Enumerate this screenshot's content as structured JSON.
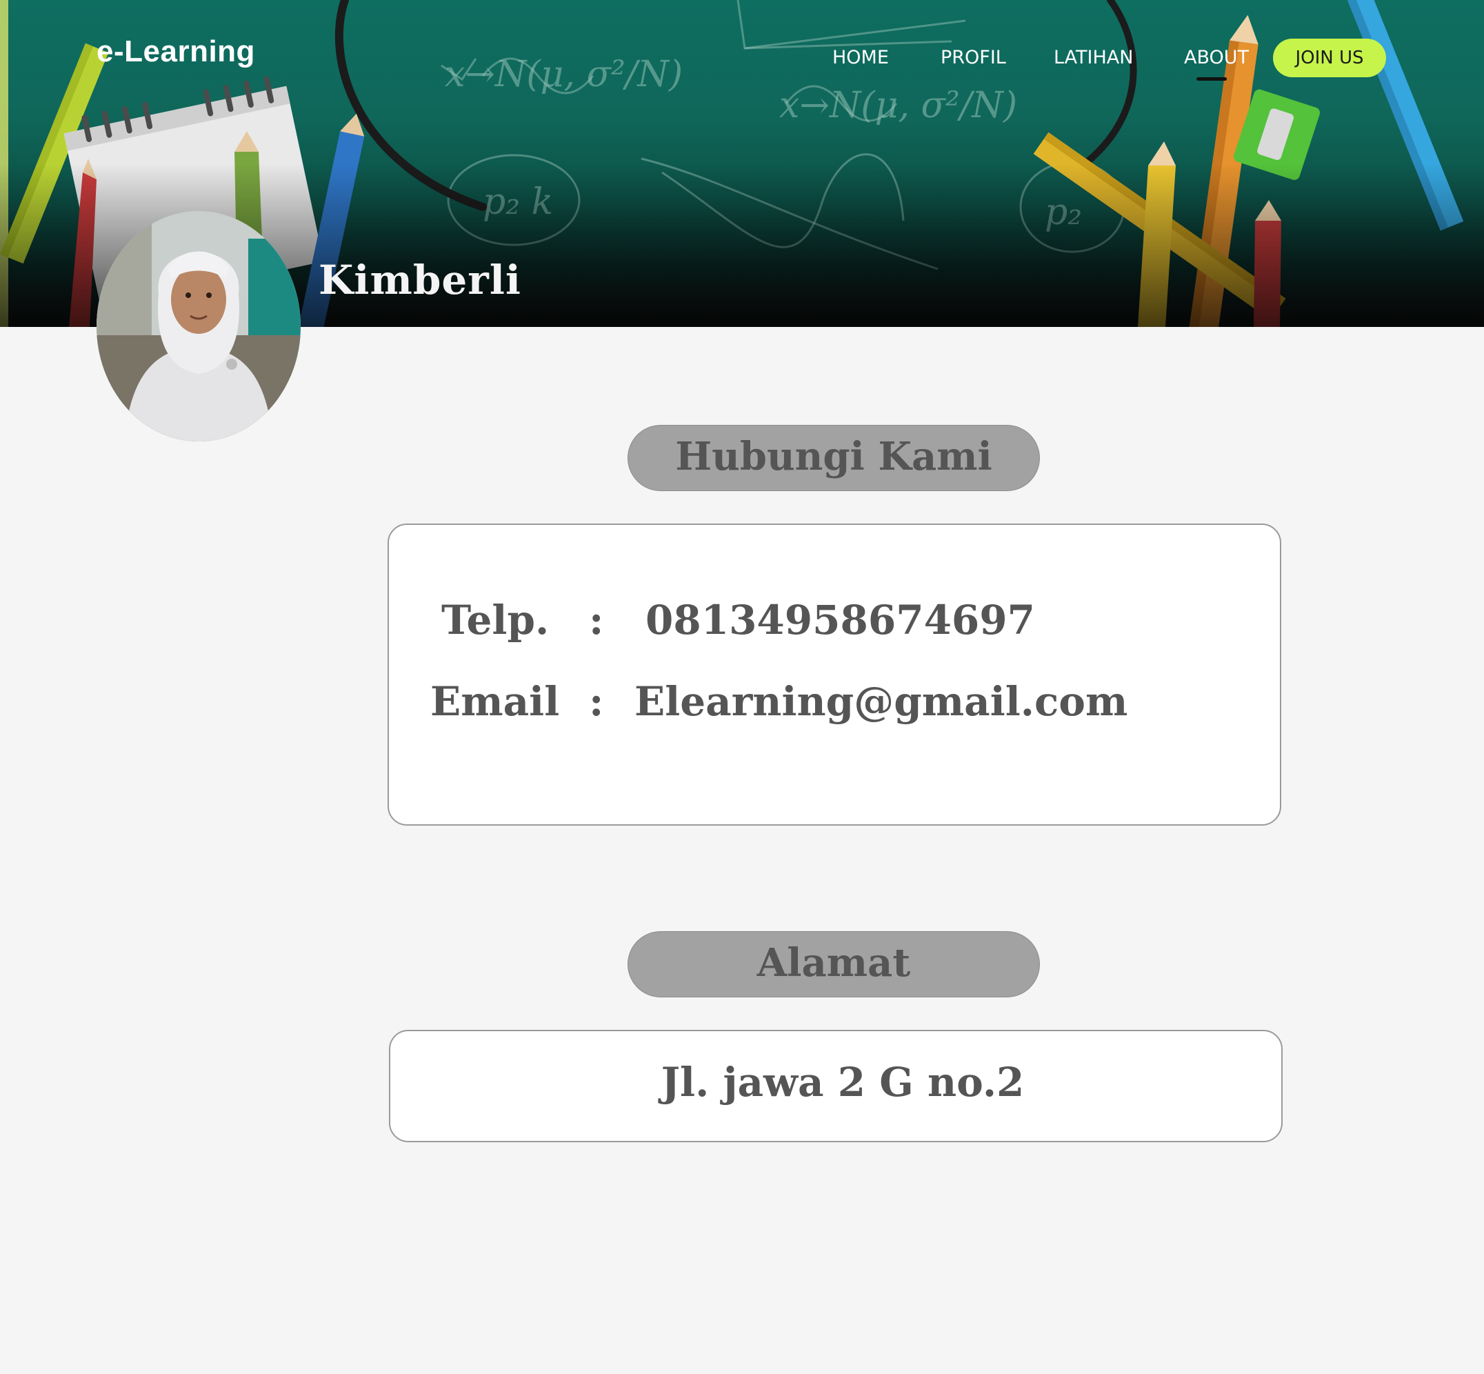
{
  "brand": "e-Learning",
  "nav": {
    "items": [
      {
        "label": "HOME"
      },
      {
        "label": "PROFIL"
      },
      {
        "label": "LATIHAN"
      },
      {
        "label": "ABOUT"
      }
    ],
    "active": "ABOUT",
    "join_label": "JOIN US"
  },
  "profile": {
    "name": "Kimberli"
  },
  "contact": {
    "heading": "Hubungi Kami",
    "telp_label": "Telp.",
    "telp_colon": ":",
    "telp_value": "08134958674697",
    "email_label": "Email",
    "email_colon": ":",
    "email_value": "Elearning@gmail.com"
  },
  "address": {
    "heading": "Alamat",
    "value": "Jl. jawa 2 G no.2"
  },
  "colors": {
    "hero_green": "#0e6e60",
    "join_button": "#c6f44a",
    "pill_gray": "#a2a2a2",
    "text_gray": "#555555",
    "page_background": "#f5f5f5"
  }
}
